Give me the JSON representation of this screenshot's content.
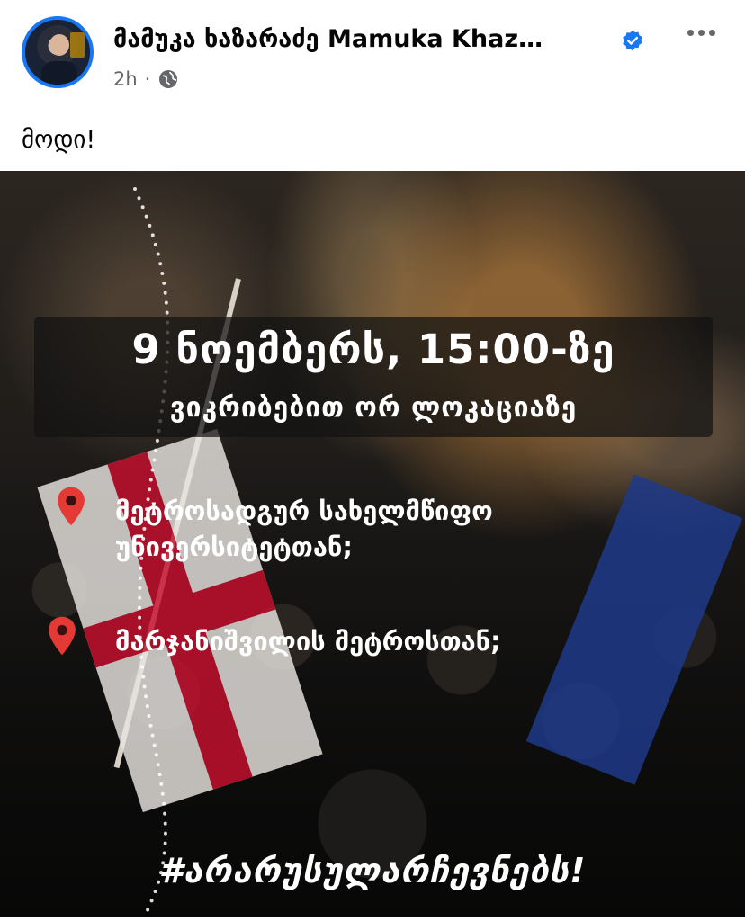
{
  "post": {
    "author_name": "მამუკა ხაზარაძე Mamuka Khaz…",
    "time": "2h",
    "separator": "·",
    "caption": "მოდი!"
  },
  "image": {
    "headline": "9 ნოემბერს, 15:00-ზე",
    "subheadline": "ვიკრიბებით ორ ლოკაციაზე",
    "locations": [
      {
        "text": "მეტროსადგურ სახელმწიფო უნივერსიტეტთან;"
      },
      {
        "text": "მარჯანიშვილის მეტროსთან;"
      }
    ],
    "hashtag": "#არარუსულარჩევნებს!"
  },
  "icons": {
    "verified": "verified-badge-icon",
    "more": "more-options-icon",
    "audience": "globe-icon",
    "location": "location-pin-icon"
  },
  "colors": {
    "accent": "#1877f2",
    "pin": "#e53935",
    "meta": "#65676b"
  }
}
